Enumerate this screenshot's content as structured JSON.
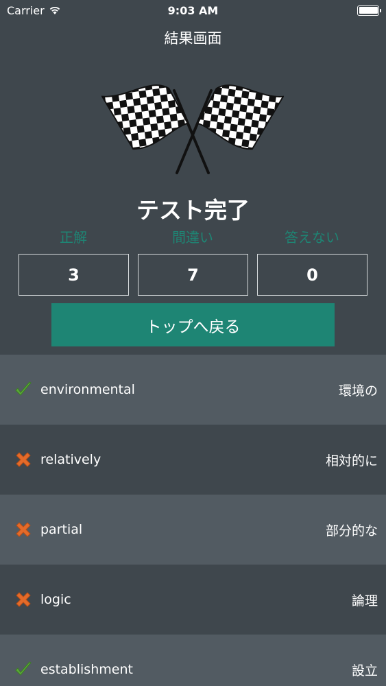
{
  "status_bar": {
    "carrier": "Carrier",
    "time": "9:03 AM"
  },
  "nav": {
    "title": "結果画面"
  },
  "result": {
    "title": "テスト完了",
    "labels": {
      "correct": "正解",
      "wrong": "間違い",
      "unanswered": "答えない"
    },
    "counts": {
      "correct": "3",
      "wrong": "7",
      "unanswered": "0"
    },
    "top_button_label": "トップへ戻る"
  },
  "colors": {
    "background": "#3f474d",
    "row_light": "#525b62",
    "accent": "#1e8574",
    "check": "#5aa63a",
    "cross": "#e36b2a"
  },
  "words": [
    {
      "word": "environmental",
      "meaning": "環境の",
      "status": "check-icon"
    },
    {
      "word": "relatively",
      "meaning": "相対的に",
      "status": "cross-icon"
    },
    {
      "word": "partial",
      "meaning": "部分的な",
      "status": "cross-icon"
    },
    {
      "word": "logic",
      "meaning": "論理",
      "status": "cross-icon"
    },
    {
      "word": "establishment",
      "meaning": "設立",
      "status": "check-icon"
    }
  ]
}
